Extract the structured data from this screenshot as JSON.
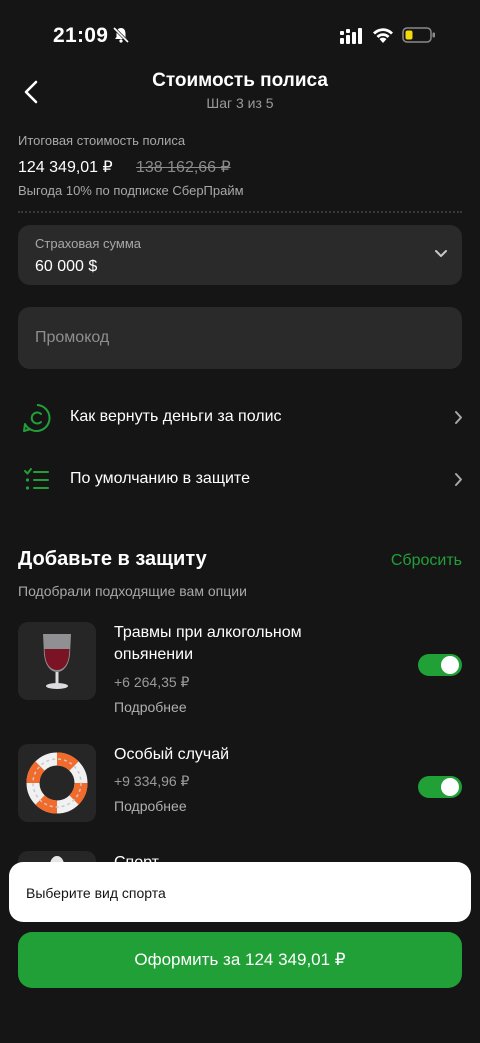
{
  "status_bar": {
    "time": "21:09"
  },
  "header": {
    "title": "Стоимость полиса",
    "step": "Шаг 3 из 5"
  },
  "summary": {
    "label": "Итоговая стоимость полиса",
    "price": "124 349,01 ₽",
    "old_price": "138 162,66 ₽",
    "discount_note": "Выгода 10% по подписке СберПрайм"
  },
  "insured_sum": {
    "label": "Страховая сумма",
    "value": "60 000 $"
  },
  "promo": {
    "placeholder": "Промокод"
  },
  "links": [
    {
      "label": "Как вернуть деньги за полис",
      "icon": "refund-icon"
    },
    {
      "label": "По умолчанию в защите",
      "icon": "checklist-icon"
    }
  ],
  "addons": {
    "title": "Добавьте в защиту",
    "reset_label": "Сбросить",
    "subtitle": "Подобрали подходящие вам опции",
    "options": [
      {
        "title": "Травмы при алкогольном опьянении",
        "price": "+6 264,35 ₽",
        "more": "Подробнее",
        "enabled": true,
        "icon": "wine-glass-icon"
      },
      {
        "title": "Особый случай",
        "price": "+9 334,96 ₽",
        "more": "Подробнее",
        "enabled": true,
        "icon": "lifebuoy-icon"
      },
      {
        "title": "Спорт",
        "icon": "sport-icon"
      }
    ]
  },
  "toast": {
    "text": "Выберите вид спорта"
  },
  "cta": {
    "label": "Оформить за 124 349,01 ₽"
  },
  "colors": {
    "accent": "#21a038",
    "background": "#151515",
    "field": "#2a2a2a"
  }
}
